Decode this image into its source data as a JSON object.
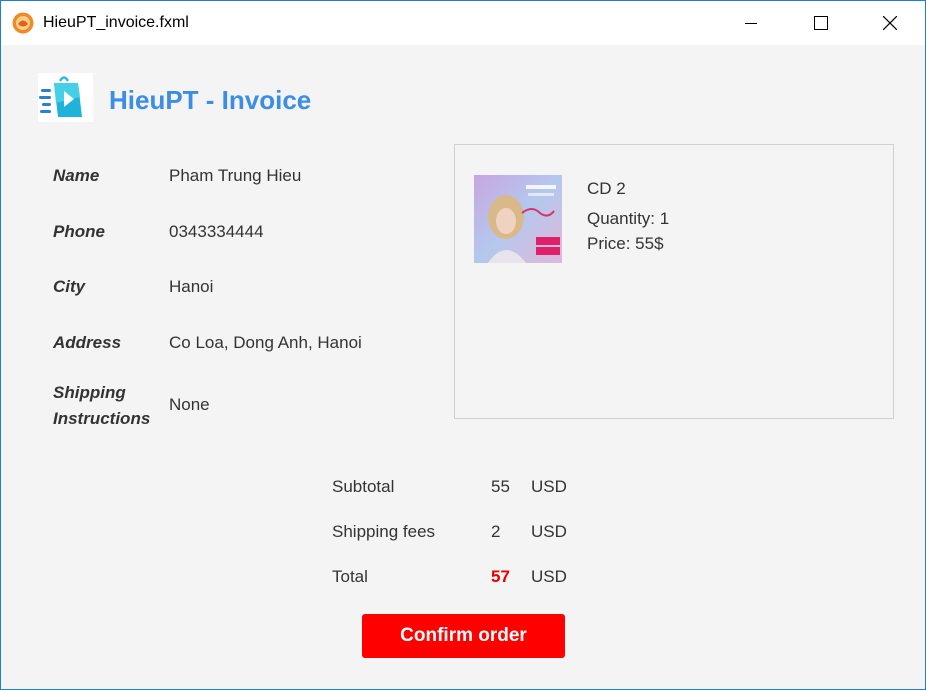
{
  "window": {
    "title": "HieuPT_invoice.fxml",
    "controls": {
      "minimize": "minimize-icon",
      "maximize": "maximize-icon",
      "close": "close-icon"
    }
  },
  "header": {
    "title": "HieuPT - Invoice"
  },
  "customer": {
    "name_label": "Name",
    "name_value": "Pham Trung Hieu",
    "phone_label": "Phone",
    "phone_value": "0343334444",
    "city_label": "City",
    "city_value": "Hanoi",
    "address_label": "Address",
    "address_value": "Co Loa, Dong Anh, Hanoi",
    "shipping_label_line1": "Shipping",
    "shipping_label_line2": "Instructions",
    "shipping_value": "None"
  },
  "cart": {
    "items": [
      {
        "name": "CD 2",
        "quantity": "Quantity: 1",
        "price": "Price: 55$",
        "thumbnail_icon": "album-cover-image"
      }
    ]
  },
  "summary": {
    "subtotal_label": "Subtotal",
    "subtotal_value": "55",
    "shipping_label": "Shipping fees",
    "shipping_value": "2",
    "total_label": "Total",
    "total_value": "57",
    "currency": "USD"
  },
  "actions": {
    "confirm_label": "Confirm order"
  },
  "colors": {
    "accent": "#3b8de6",
    "total": "#e60000",
    "confirm": "#ff0000"
  }
}
